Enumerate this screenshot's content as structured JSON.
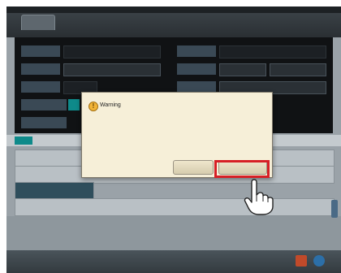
{
  "dialog": {
    "title": "Warning",
    "message": "",
    "ok_label": "",
    "cancel_label": ""
  },
  "colors": {
    "highlight": "#d61f26",
    "dialog_bg": "#f6efd8",
    "teal": "#0e8a8a"
  },
  "icons": {
    "warning": "warning-icon",
    "pointer": "pointing-hand-icon"
  }
}
